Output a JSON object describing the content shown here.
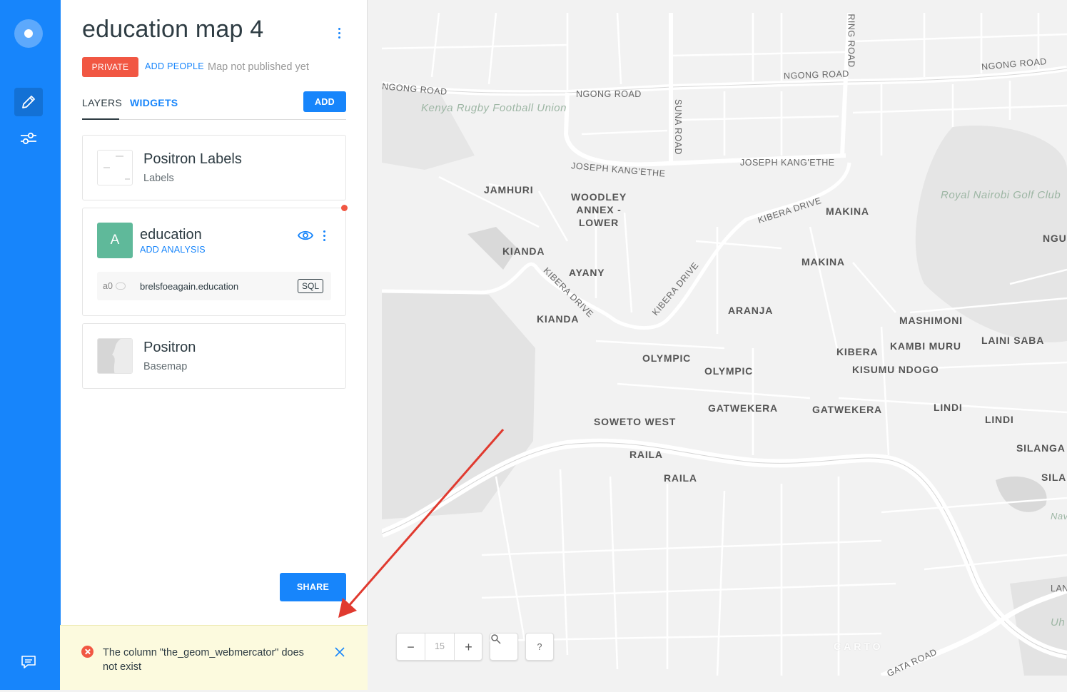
{
  "sidebar": {
    "logo_icon": "carto-logo-icon",
    "edit_icon": "pencil-icon",
    "settings_icon": "sliders-icon",
    "feedback_icon": "chat-icon"
  },
  "panel": {
    "title": "education map 4",
    "privacy": "PRIVATE",
    "add_people": "ADD PEOPLE",
    "publish_status": "Map not published yet",
    "tabs": {
      "layers": "LAYERS",
      "widgets": "WIDGETS"
    },
    "add_label": "ADD",
    "layers": [
      {
        "title": "Positron Labels",
        "subtitle": "Labels"
      },
      {
        "letter": "A",
        "title": "education",
        "add_analysis": "ADD ANALYSIS",
        "node_id": "a0",
        "source": "brelsfoeagain.education",
        "sql_label": "SQL"
      },
      {
        "title": "Positron",
        "subtitle": "Basemap"
      }
    ],
    "share_label": "SHARE"
  },
  "error": {
    "message": "The column \"the_geom_webmercator\" does not exist"
  },
  "map": {
    "zoom": "15",
    "zoom_out": "−",
    "zoom_in": "+",
    "search_icon": "search-icon",
    "help_label": "?",
    "attribution": "CARTO",
    "labels": {
      "ngong_road_1": "NGONG ROAD",
      "ngong_road_2": "NGONG ROAD",
      "ngong_road_3": "NGONG ROAD",
      "ngong_road_4": "NGONG ROAD",
      "ring_road": "RING ROAD",
      "suna_road": "SUNA ROAD",
      "rugby": "Kenya Rugby Football Union",
      "jk_1": "JOSEPH KANG'ETHE",
      "jk_2": "JOSEPH KANG'ETHE",
      "jamhuri": "JAMHURI",
      "woodley": "WOODLEY ANNEX - LOWER",
      "kibera_drive_1": "KIBERA DRIVE",
      "makina_1": "MAKINA",
      "makina_2": "MAKINA",
      "golf": "Royal Nairobi Golf Club",
      "ngu": "NGU",
      "kianda_1": "KIANDA",
      "ayany": "AYANY",
      "kibera_drive_2": "KIBERA DRIVE",
      "kibera_drive_3": "KIBERA DRIVE",
      "kianda_2": "KIANDA",
      "aranja": "ARANJA",
      "mashimoni": "MASHIMONI",
      "laini_saba": "LAINI SABA",
      "kibera": "KIBERA",
      "kambi_muru": "KAMBI MURU",
      "olympic_1": "OLYMPIC",
      "olympic_2": "OLYMPIC",
      "kisumu": "KISUMU NDOGO",
      "gatwekera_1": "GATWEKERA",
      "gatwekera_2": "GATWEKERA",
      "lindi_1": "LINDI",
      "lindi_2": "LINDI",
      "soweto": "SOWETO WEST",
      "silanga_1": "SILANGA",
      "silanga_2": "SILAN",
      "raila_1": "RAILA",
      "raila_2": "RAILA",
      "nav": "Nav",
      "lan": "LAN",
      "uh": "Uh",
      "gata_road": "GATA ROAD"
    }
  },
  "colors": {
    "brand": "#1785fb",
    "private": "#f15743",
    "layer_letter": "#5fb99a",
    "error_bg": "#fcfade",
    "annotation_arrow": "#e03a2f"
  }
}
